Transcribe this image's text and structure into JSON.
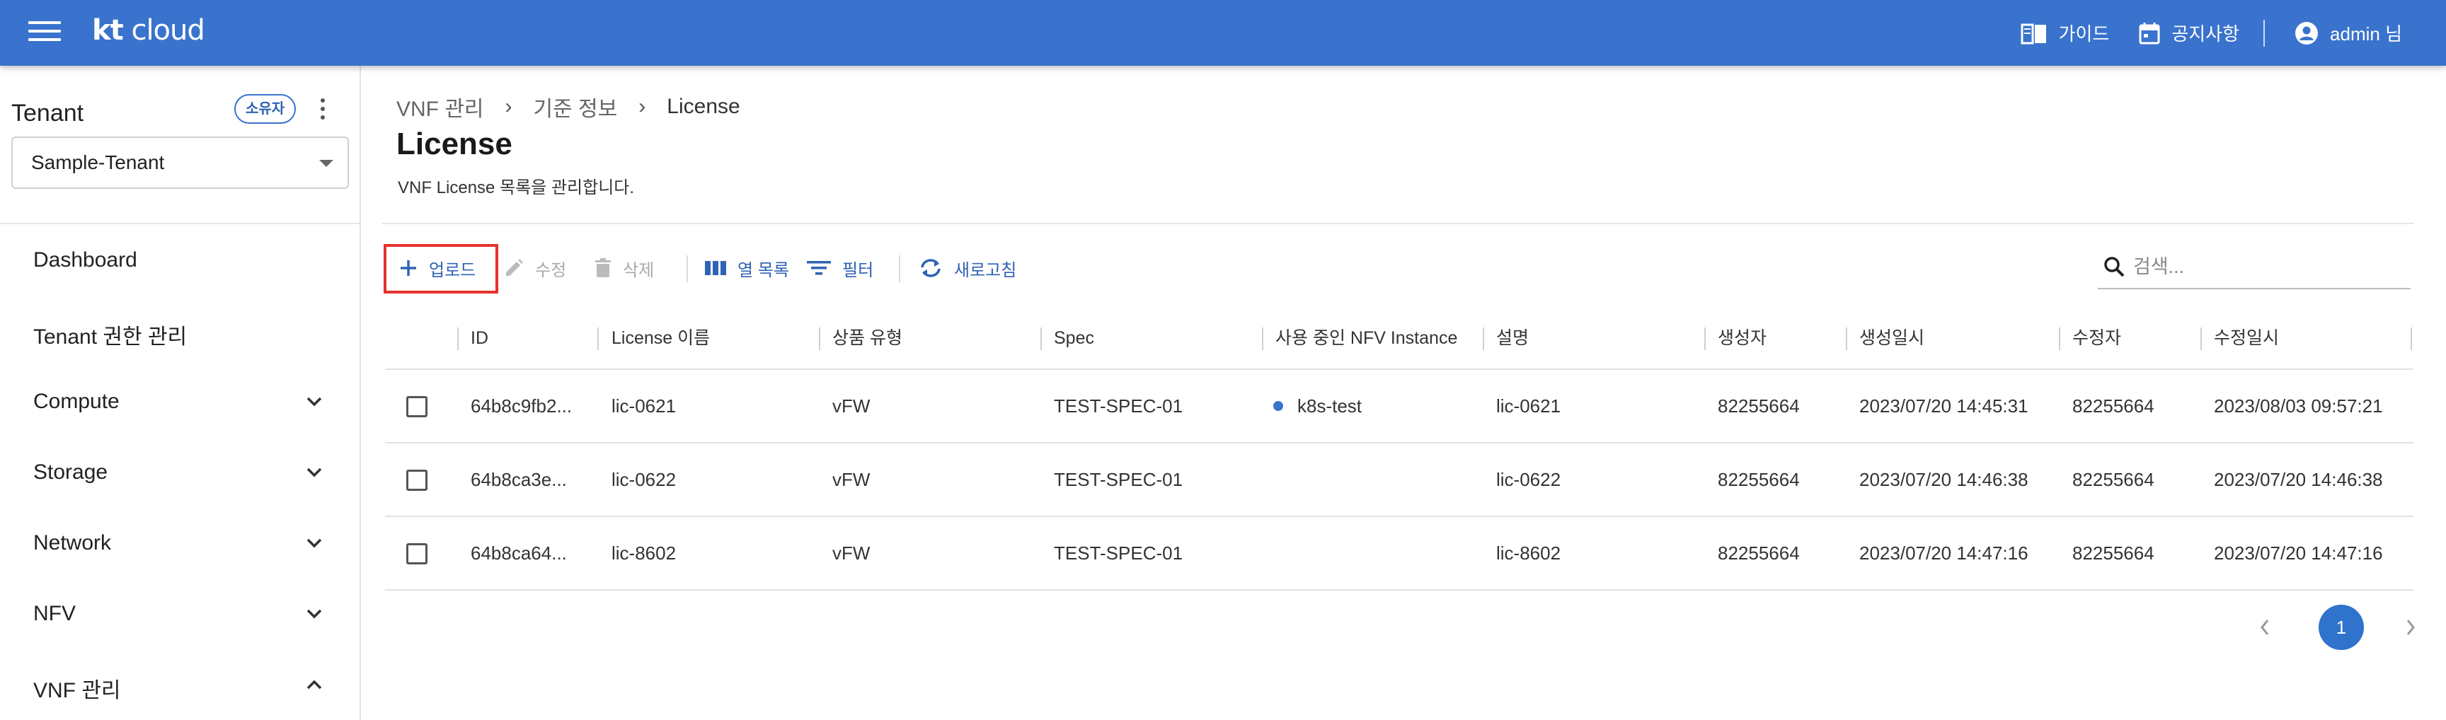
{
  "header": {
    "logo_kt": "kt",
    "logo_cloud": " cloud",
    "guide": "가이드",
    "notice": "공지사항",
    "user": "admin 님"
  },
  "sidebar": {
    "tenant_title": "Tenant",
    "owner_badge": "소유자",
    "tenant_selected": "Sample-Tenant",
    "items": [
      {
        "label": "Dashboard",
        "chevron": "none"
      },
      {
        "label": "Tenant 권한 관리",
        "chevron": "none"
      },
      {
        "label": "Compute",
        "chevron": "down"
      },
      {
        "label": "Storage",
        "chevron": "down"
      },
      {
        "label": "Network",
        "chevron": "down"
      },
      {
        "label": "NFV",
        "chevron": "down"
      },
      {
        "label": "VNF 관리",
        "chevron": "up"
      }
    ]
  },
  "main": {
    "breadcrumb": [
      "VNF 관리",
      "기준 정보",
      "License"
    ],
    "title": "License",
    "description": "VNF License 목록을 관리합니다.",
    "toolbar": {
      "upload": "업로드",
      "edit": "수정",
      "delete": "삭제",
      "columns": "열 목록",
      "filter": "필터",
      "refresh": "새로고침"
    },
    "search": {
      "placeholder": "검색..."
    },
    "table": {
      "columns": [
        "ID",
        "License 이름",
        "상품 유형",
        "Spec",
        "사용 중인 NFV Instance",
        "설명",
        "생성자",
        "생성일시",
        "수정자",
        "수정일시"
      ],
      "rows": [
        {
          "id": "64b8c9fb2...",
          "name": "lic-0621",
          "type": "vFW",
          "spec": "TEST-SPEC-01",
          "instance": "k8s-test",
          "desc": "lic-0621",
          "creator": "82255664",
          "created": "2023/07/20 14:45:31",
          "modifier": "82255664",
          "modified": "2023/08/03 09:57:21"
        },
        {
          "id": "64b8ca3e...",
          "name": "lic-0622",
          "type": "vFW",
          "spec": "TEST-SPEC-01",
          "instance": "",
          "desc": "lic-0622",
          "creator": "82255664",
          "created": "2023/07/20 14:46:38",
          "modifier": "82255664",
          "modified": "2023/07/20 14:46:38"
        },
        {
          "id": "64b8ca64...",
          "name": "lic-8602",
          "type": "vFW",
          "spec": "TEST-SPEC-01",
          "instance": "",
          "desc": "lic-8602",
          "creator": "82255664",
          "created": "2023/07/20 14:47:16",
          "modifier": "82255664",
          "modified": "2023/07/20 14:47:16"
        }
      ]
    },
    "pagination": {
      "current": "1"
    }
  },
  "colors": {
    "primary": "#3a73cd",
    "highlight": "#e5322c",
    "status_dot": "#3a73cd"
  }
}
